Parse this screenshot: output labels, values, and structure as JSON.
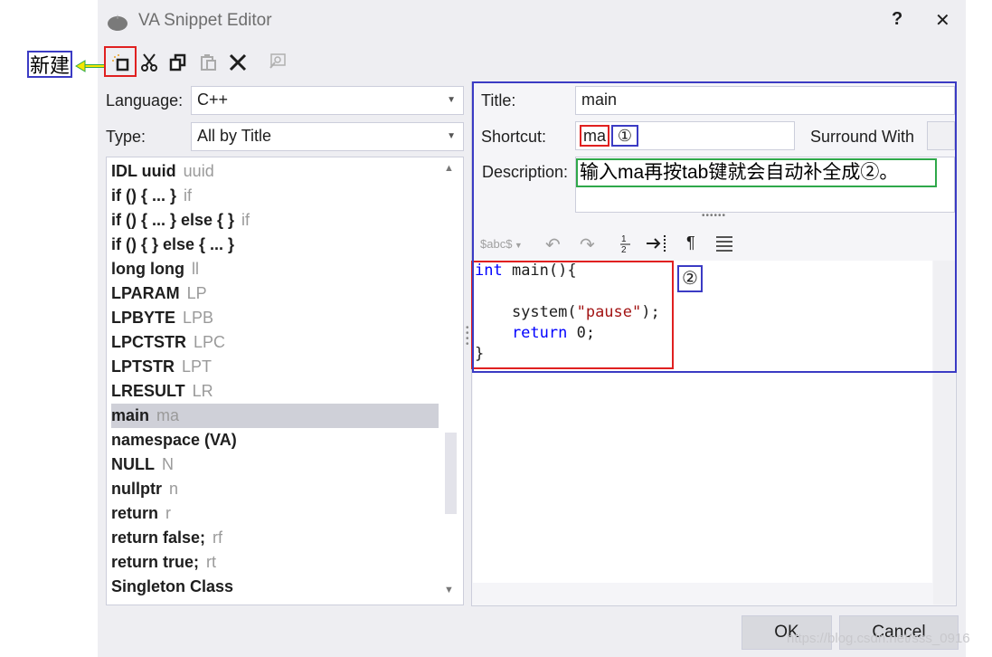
{
  "window": {
    "title": "VA Snippet Editor",
    "help": "?",
    "close": "✕"
  },
  "annotations": {
    "new_label": "新建",
    "circle1": "①",
    "circle2": "②"
  },
  "toolbar": {
    "items": [
      "new-icon",
      "cut-icon",
      "copy-icon",
      "paste-icon",
      "delete-icon",
      "find-icon"
    ]
  },
  "left": {
    "language_label": "Language:",
    "language_value": "C++",
    "type_label": "Type:",
    "type_value": "All by Title",
    "snippets": [
      {
        "name": "IDL uuid",
        "shortcut": "uuid"
      },
      {
        "name": "if () { ... }",
        "shortcut": "if"
      },
      {
        "name": "if () { ... } else { }",
        "shortcut": "if"
      },
      {
        "name": "if () { } else { ... }",
        "shortcut": ""
      },
      {
        "name": "long long",
        "shortcut": "ll"
      },
      {
        "name": "LPARAM",
        "shortcut": "LP"
      },
      {
        "name": "LPBYTE",
        "shortcut": "LPB"
      },
      {
        "name": "LPCTSTR",
        "shortcut": "LPC"
      },
      {
        "name": "LPTSTR",
        "shortcut": "LPT"
      },
      {
        "name": "LRESULT",
        "shortcut": "LR"
      },
      {
        "name": "main",
        "shortcut": "ma"
      },
      {
        "name": "namespace (VA)",
        "shortcut": ""
      },
      {
        "name": "NULL",
        "shortcut": "N"
      },
      {
        "name": "nullptr",
        "shortcut": "n"
      },
      {
        "name": "return",
        "shortcut": "r"
      },
      {
        "name": "return false;",
        "shortcut": "rf"
      },
      {
        "name": "return true;",
        "shortcut": "rt"
      },
      {
        "name": "Singleton Class",
        "shortcut": ""
      }
    ]
  },
  "right": {
    "title_label": "Title:",
    "title_value": "main",
    "shortcut_label": "Shortcut:",
    "shortcut_value": "ma",
    "surround_label": "Surround With",
    "description_label": "Description:",
    "description_value": "输入ma再按tab键就会自动补全成②。",
    "editor_toolbar": {
      "abc": "$abc$",
      "pilcrow": "¶"
    },
    "code": {
      "l1_kw": "int",
      "l1_rest": " main(){",
      "l3_a": "    system(",
      "l3_str": "\"pause\"",
      "l3_b": ");",
      "l4_kw": "    return",
      "l4_rest": " 0;",
      "l5": "}"
    }
  },
  "buttons": {
    "ok": "OK",
    "cancel": "Cancel"
  },
  "watermark": "https://blog.csdn.net/sss_0916",
  "colors": {
    "annotation_red": "#e02020",
    "annotation_blue": "#3b3bc4",
    "annotation_green": "#2fa84a",
    "keyword": "#0000ff",
    "string": "#a31515",
    "selection": "#cfd0d8"
  }
}
